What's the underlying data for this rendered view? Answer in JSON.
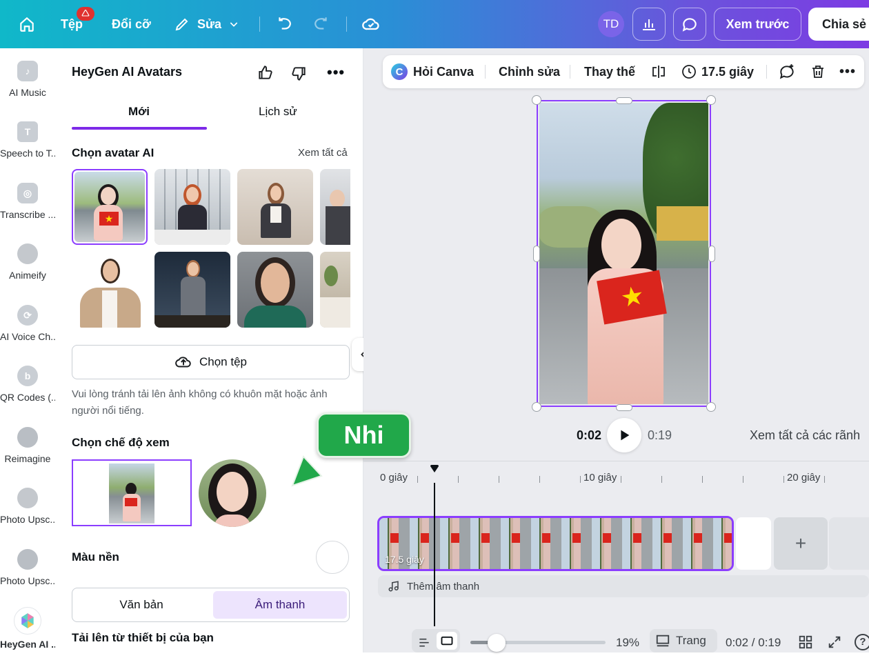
{
  "topbar": {
    "file_label": "Tệp",
    "file_badge": "🛆",
    "resize_label": "Đổi cỡ",
    "edit_label": "Sửa",
    "user_initials": "TD",
    "preview_label": "Xem trước",
    "share_label": "Chia sẻ"
  },
  "rail": {
    "items": [
      {
        "label": "AI Music"
      },
      {
        "label": "Speech to T..."
      },
      {
        "label": "Transcribe ..."
      },
      {
        "label": "Animeify"
      },
      {
        "label": "AI Voice Ch..."
      },
      {
        "label": "QR Codes (..."
      },
      {
        "label": "Reimagine"
      },
      {
        "label": "Photo Upsc..."
      },
      {
        "label": "Photo Upsc..."
      },
      {
        "label": "HeyGen AI ..."
      }
    ]
  },
  "panel": {
    "title": "HeyGen AI Avatars",
    "tabs": [
      {
        "label": "Mới"
      },
      {
        "label": "Lịch sử"
      }
    ],
    "choose_avatar": "Chọn avatar AI",
    "see_all": "Xem tất cả",
    "upload_label": "Chọn tệp",
    "hint": "Vui lòng tránh tải lên ảnh không có khuôn mặt hoặc ảnh người nổi tiếng.",
    "view_mode_title": "Chọn chế độ xem",
    "bg_color_label": "Màu nền",
    "segment": [
      {
        "label": "Văn bản"
      },
      {
        "label": "Âm thanh"
      }
    ],
    "upload_device_title": "Tải lên từ thiết bị của bạn"
  },
  "context_bar": {
    "ask_canva": "Hỏi Canva",
    "edit": "Chỉnh sửa",
    "replace": "Thay thế",
    "duration": "17.5 giây"
  },
  "playback": {
    "current": "0:02",
    "total": "0:19",
    "see_all_tracks": "Xem tất cả các rãnh"
  },
  "timeline": {
    "ticks": [
      "0 giây",
      "10 giây",
      "20 giây"
    ],
    "clip_duration": "17.5 giây",
    "add_audio": "Thêm âm thanh"
  },
  "bottom": {
    "zoom": "19%",
    "pages_label": "Trang",
    "time": "0:02 / 0:19"
  },
  "overlay": {
    "name_tag": "Nhi"
  },
  "colors": {
    "accent": "#8b3dff",
    "tag_green": "#21a84a",
    "segment_active": "#ede4fd"
  }
}
